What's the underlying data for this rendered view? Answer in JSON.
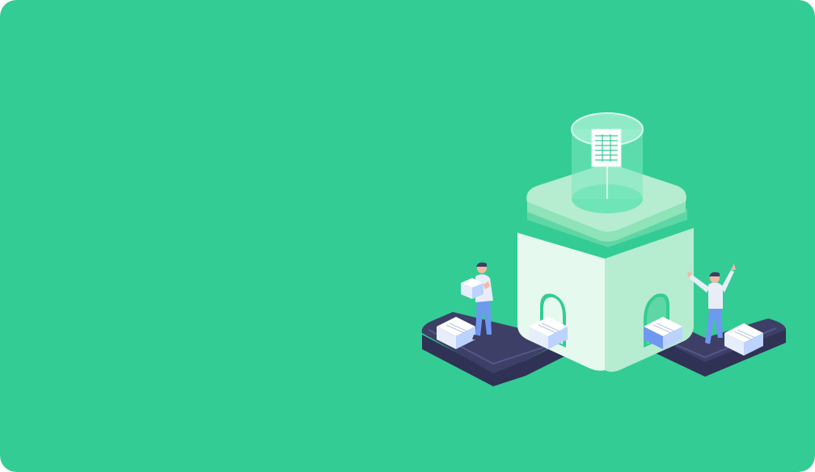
{
  "background": {
    "color": "#33cc94"
  },
  "illustration": {
    "subject": "isometric-processing-building-with-conveyor",
    "palette": {
      "building_light": "#e6f9ee",
      "building_mid": "#b6ecd0",
      "building_roof": "#8ee3b9",
      "building_shadow": "#5fd6a5",
      "conveyor_dark": "#3d3f66",
      "conveyor_edge": "#54578a",
      "box_front": "#ffffff",
      "box_side": "#bcd3ff",
      "box_blue": "#6f98f0",
      "glass": "#7ee9c0",
      "person_pants": "#6f98f0",
      "person_shirt": "#e8edf7",
      "person_hair": "#3d3f66",
      "skin": "#f2b9a3"
    },
    "icons": [
      "document-icon",
      "box-icon",
      "person-icon",
      "conveyor-icon",
      "building-icon"
    ]
  }
}
